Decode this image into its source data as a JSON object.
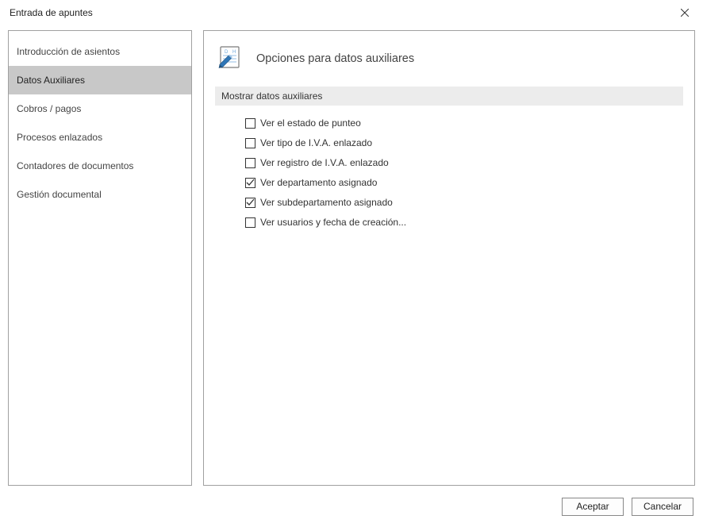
{
  "window": {
    "title": "Entrada de apuntes"
  },
  "sidebar": {
    "items": [
      {
        "label": "Introducción de asientos",
        "selected": false
      },
      {
        "label": "Datos Auxiliares",
        "selected": true
      },
      {
        "label": "Cobros / pagos",
        "selected": false
      },
      {
        "label": "Procesos enlazados",
        "selected": false
      },
      {
        "label": "Contadores de documentos",
        "selected": false
      },
      {
        "label": "Gestión documental",
        "selected": false
      }
    ]
  },
  "main": {
    "section_title": "Opciones para datos auxiliares",
    "group_label": "Mostrar datos auxiliares",
    "checks": [
      {
        "label": "Ver el estado de punteo",
        "checked": false
      },
      {
        "label": "Ver tipo de I.V.A. enlazado",
        "checked": false
      },
      {
        "label": "Ver registro de I.V.A. enlazado",
        "checked": false
      },
      {
        "label": "Ver departamento asignado",
        "checked": true
      },
      {
        "label": "Ver subdepartamento asignado",
        "checked": true
      },
      {
        "label": "Ver usuarios y fecha de creación...",
        "checked": false
      }
    ]
  },
  "footer": {
    "accept_label": "Aceptar",
    "cancel_label": "Cancelar"
  }
}
